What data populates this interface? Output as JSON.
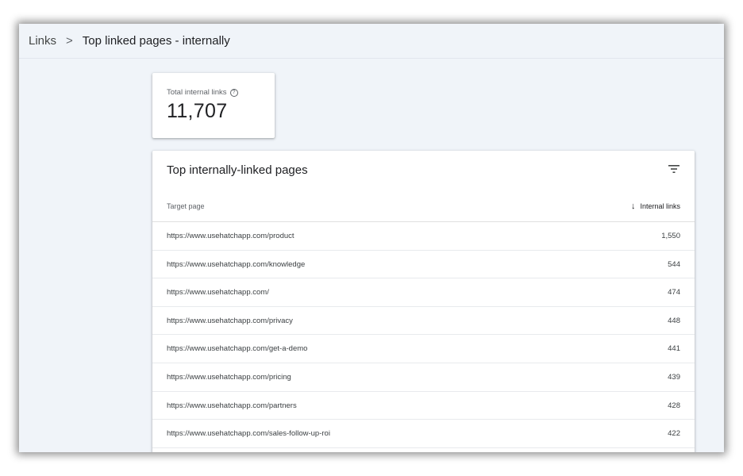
{
  "breadcrumb": {
    "parent": "Links",
    "separator": ">",
    "current": "Top linked pages - internally"
  },
  "summary": {
    "label": "Total internal links",
    "value": "11,707",
    "help_icon": "help-circle-icon"
  },
  "table": {
    "title": "Top internally-linked pages",
    "filter_icon": "filter-icon",
    "columns": {
      "target": "Target page",
      "links": "Internal links",
      "sort_icon": "arrow-down-icon"
    },
    "rows": [
      {
        "url": "https://www.usehatchapp.com/product",
        "count": "1,550"
      },
      {
        "url": "https://www.usehatchapp.com/knowledge",
        "count": "544"
      },
      {
        "url": "https://www.usehatchapp.com/",
        "count": "474"
      },
      {
        "url": "https://www.usehatchapp.com/privacy",
        "count": "448"
      },
      {
        "url": "https://www.usehatchapp.com/get-a-demo",
        "count": "441"
      },
      {
        "url": "https://www.usehatchapp.com/pricing",
        "count": "439"
      },
      {
        "url": "https://www.usehatchapp.com/partners",
        "count": "428"
      },
      {
        "url": "https://www.usehatchapp.com/sales-follow-up-roi",
        "count": "422"
      }
    ]
  }
}
